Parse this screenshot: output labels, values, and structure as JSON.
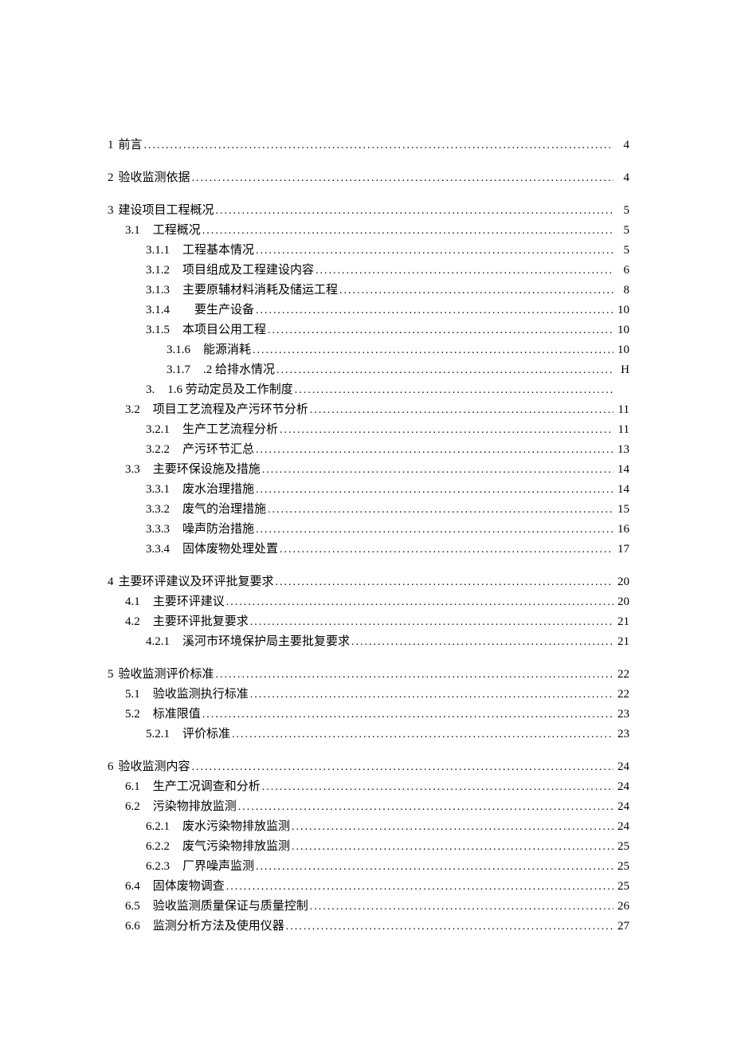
{
  "toc": [
    {
      "level": 0,
      "num": "1",
      "title": "前言",
      "page": "4",
      "spaced": true
    },
    {
      "level": 0,
      "num": "2",
      "title": "验收监测依据",
      "page": "4",
      "spaced": true
    },
    {
      "level": 0,
      "num": "3",
      "title": "建设项目工程概况",
      "page": "5",
      "spaced": true
    },
    {
      "level": 1,
      "num": "3.1",
      "title": "工程概况",
      "page": "5"
    },
    {
      "level": 2,
      "num": "3.1.1",
      "title": "工程基本情况",
      "page": "5"
    },
    {
      "level": 2,
      "num": "3.1.2",
      "title": "项目组成及工程建设内容",
      "page": "6"
    },
    {
      "level": 2,
      "num": "3.1.3",
      "title": "主要原辅材料消耗及储运工程",
      "page": "8"
    },
    {
      "level": 2,
      "num": "3.1.4",
      "title": "　要生产设备",
      "page": "10"
    },
    {
      "level": 2,
      "num": "3.1.5",
      "title": "本项目公用工程",
      "page": "10"
    },
    {
      "level": 3,
      "num": "3.1.6",
      "title": "能源消耗",
      "page": "10"
    },
    {
      "level": 3,
      "num": "3.1.7",
      "title": ".2 给排水情况",
      "page": "H"
    },
    {
      "level": 2,
      "num": "3.",
      "title": "1.6 劳动定员及工作制度",
      "page": ""
    },
    {
      "level": 1,
      "num": "3.2",
      "title": "项目工艺流程及产污环节分析",
      "page": "11"
    },
    {
      "level": 2,
      "num": "3.2.1",
      "title": "生产工艺流程分析",
      "page": "11"
    },
    {
      "level": 2,
      "num": "3.2.2",
      "title": "产污环节汇总",
      "page": "13"
    },
    {
      "level": 1,
      "num": "3.3",
      "title": "主要环保设施及措施",
      "page": "14"
    },
    {
      "level": 2,
      "num": "3.3.1",
      "title": "废水治理措施",
      "page": "14"
    },
    {
      "level": 2,
      "num": "3.3.2",
      "title": "废气的治理措施",
      "page": "15"
    },
    {
      "level": 2,
      "num": "3.3.3",
      "title": "噪声防治措施",
      "page": "16"
    },
    {
      "level": 2,
      "num": "3.3.4",
      "title": "固体废物处理处置",
      "page": "17"
    },
    {
      "level": 0,
      "num": "4",
      "title": "主要环评建议及环评批复要求",
      "page": "20",
      "spaced": true
    },
    {
      "level": 1,
      "num": "4.1",
      "title": "主要环评建议",
      "page": "20"
    },
    {
      "level": 1,
      "num": "4.2",
      "title": "主要环评批复要求",
      "page": "21"
    },
    {
      "level": 2,
      "num": "4.2.1",
      "title": "溪河市环境保护局主要批复要求",
      "page": "21"
    },
    {
      "level": 0,
      "num": "5",
      "title": "验收监测评价标准",
      "page": "22",
      "spaced": true
    },
    {
      "level": 1,
      "num": "5.1",
      "title": "验收监测执行标准",
      "page": "22"
    },
    {
      "level": 1,
      "num": "5.2",
      "title": "标准限值",
      "page": "23"
    },
    {
      "level": 2,
      "num": "5.2.1",
      "title": "评价标准",
      "page": "23"
    },
    {
      "level": 0,
      "num": "6",
      "title": "验收监测内容",
      "page": "24",
      "spaced": true
    },
    {
      "level": 1,
      "num": "6.1",
      "title": "生产工况调查和分析",
      "page": "24"
    },
    {
      "level": 1,
      "num": "6.2",
      "title": "污染物排放监测",
      "page": "24"
    },
    {
      "level": 2,
      "num": "6.2.1",
      "title": "废水污染物排放监测",
      "page": "24"
    },
    {
      "level": 2,
      "num": "6.2.2",
      "title": "废气污染物排放监测",
      "page": "25"
    },
    {
      "level": 2,
      "num": "6.2.3",
      "title": "厂界噪声监测",
      "page": "25"
    },
    {
      "level": 1,
      "num": "6.4",
      "title": "固体废物调查",
      "page": "25"
    },
    {
      "level": 1,
      "num": "6.5",
      "title": "验收监测质量保证与质量控制",
      "page": "26"
    },
    {
      "level": 1,
      "num": "6.6",
      "title": "监测分析方法及使用仪器",
      "page": "27"
    }
  ]
}
